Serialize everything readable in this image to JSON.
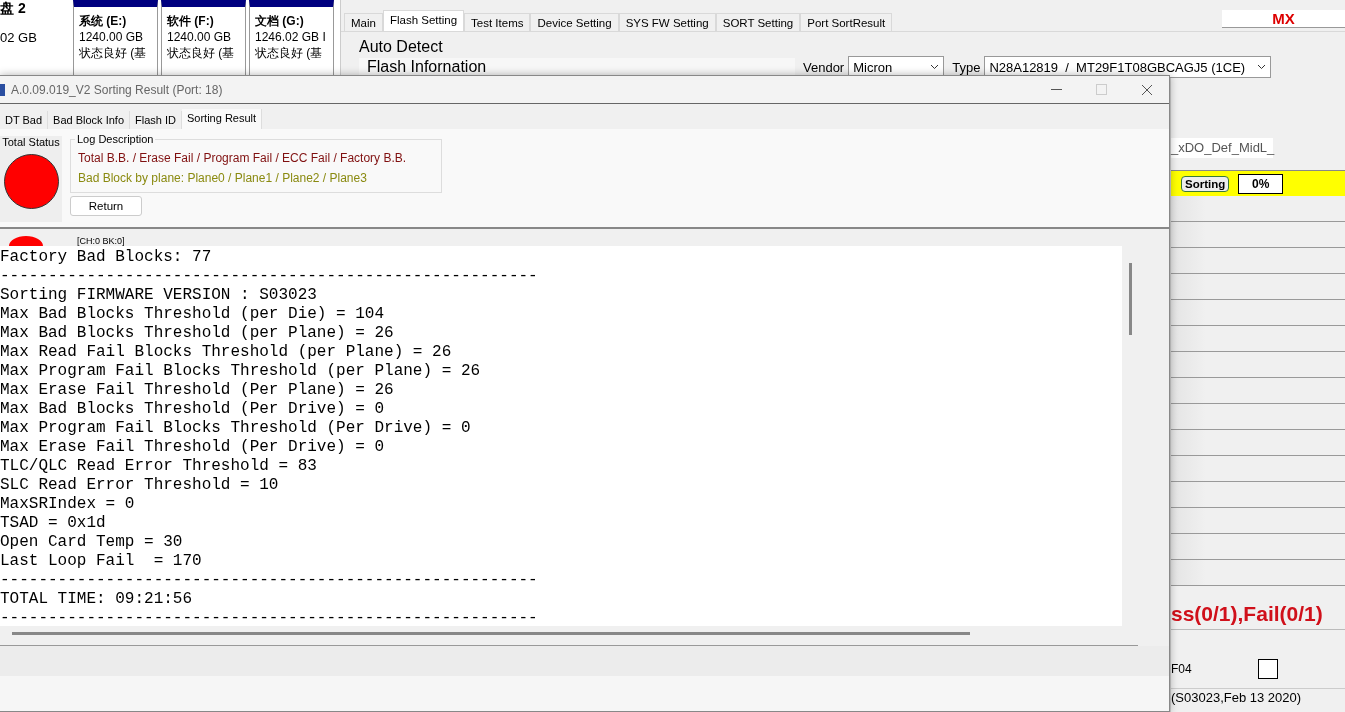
{
  "disk_panel": {
    "disk_label": "盘 2",
    "disk_size": "02 GB",
    "partitions": [
      {
        "name": "系统 (E:)",
        "size": "1240.00 GB",
        "status": "状态良好 (基"
      },
      {
        "name": "软件 (F:)",
        "size": "1240.00 GB",
        "status": "状态良好 (基"
      },
      {
        "name": "文档 (G:)",
        "size": "1246.02 GB I",
        "status": "状态良好 (基"
      }
    ]
  },
  "main_window": {
    "tabs": [
      {
        "label": "Main",
        "selected": false
      },
      {
        "label": "Flash Setting",
        "selected": true
      },
      {
        "label": "Test Items",
        "selected": false
      },
      {
        "label": "Device Setting",
        "selected": false
      },
      {
        "label": "SYS FW Setting",
        "selected": false
      },
      {
        "label": "SORT Setting",
        "selected": false
      },
      {
        "label": "Port SortResult",
        "selected": false
      }
    ],
    "corner_label": "MX",
    "group_title": "Auto Detect",
    "section_title": "Flash Infornation",
    "vendor": {
      "label": "Vendor",
      "value": "Micron"
    },
    "type": {
      "label": "Type",
      "value": "N28A12819  /  MT29F1T08GBCAGJ5 (1CE)"
    },
    "side_panel": {
      "field_value": "_xDO_Def_MidL_",
      "status_button": "Sorting",
      "progress_text": "0%",
      "summary": "ss(0/1),Fail(0/1)",
      "item_label": "F04",
      "checked": false,
      "footer": "(S03023,Feb 13 2020)"
    }
  },
  "dialog": {
    "title": "A.0.09.019_V2 Sorting Result (Port: 18)",
    "tabs": [
      {
        "label": "DT Bad",
        "selected": false
      },
      {
        "label": "Bad Block Info",
        "selected": false
      },
      {
        "label": "Flash ID",
        "selected": false
      },
      {
        "label": "Sorting Result",
        "selected": true
      }
    ],
    "total_status": {
      "label": "Total Status",
      "color": "#ff0000"
    },
    "log_description": {
      "title": "Log Description",
      "lines": [
        {
          "kind": "totals",
          "text": "Total B.B. / Erase Fail / Program Fail / ECC Fail / Factory B.B."
        },
        {
          "kind": "planes",
          "text": "Bad Block by plane: Plane0 / Plane1 / Plane2 / Plane3"
        }
      ]
    },
    "return_button": "Return",
    "channel_label": "[CH:0 BK:0]",
    "log_lines": [
      "Factory Bad Blocks: 77",
      "--------------------------------------------------------",
      "Sorting FIRMWARE VERSION : S03023",
      "Max Bad Blocks Threshold (per Die) = 104",
      "Max Bad Blocks Threshold (per Plane) = 26",
      "Max Read Fail Blocks Threshold (per Plane) = 26",
      "Max Program Fail Blocks Threshold (per Plane) = 26",
      "Max Erase Fail Threshold (Per Plane) = 26",
      "Max Bad Blocks Threshold (Per Drive) = 0",
      "Max Program Fail Blocks Threshold (Per Drive) = 0",
      "Max Erase Fail Threshold (Per Drive) = 0",
      "TLC/QLC Read Error Threshold = 83",
      "SLC Read Error Threshold = 10",
      "MaxSRIndex = 0",
      "TSAD = 0x1d",
      "Open Card Temp = 30",
      "Last Loop Fail  = 170",
      "--------------------------------------------------------",
      "TOTAL TIME: 09:21:56",
      "--------------------------------------------------------"
    ]
  }
}
